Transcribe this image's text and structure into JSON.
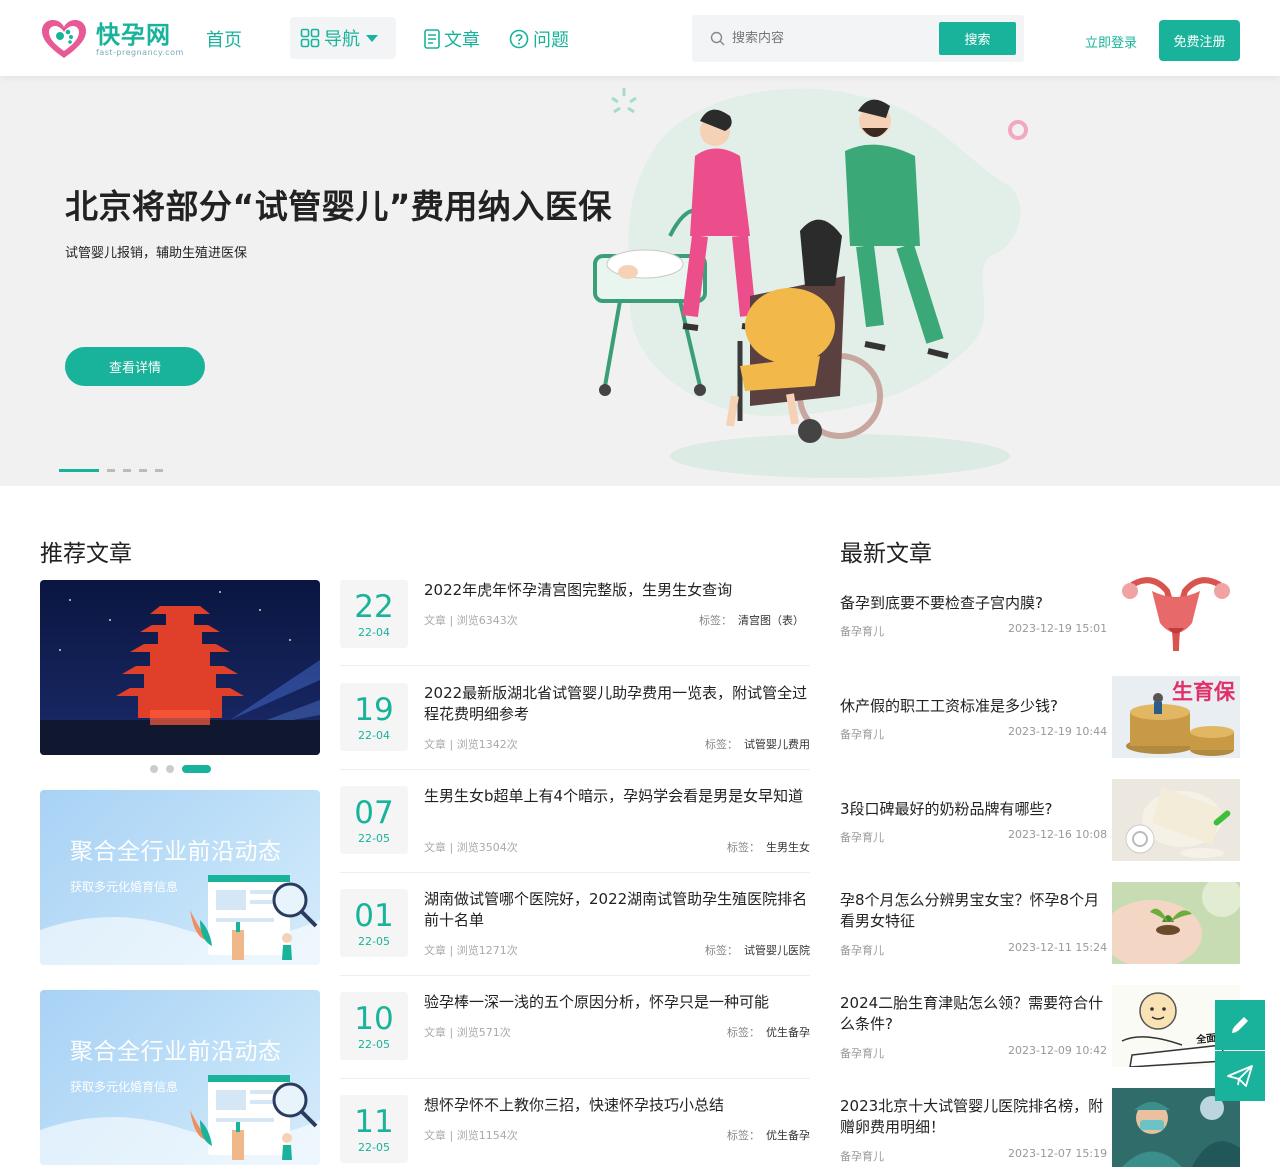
{
  "header": {
    "logo_title": "快孕网",
    "logo_sub": "fast-pregnancy.com",
    "nav_home": "首页",
    "nav_dropdown": "导航",
    "nav_articles": "文章",
    "nav_questions": "问题",
    "search_placeholder": "搜索内容",
    "search_button": "搜索",
    "login": "立即登录",
    "register": "免费注册"
  },
  "banner": {
    "title": "北京将部分“试管婴儿”费用纳入医保",
    "subtitle": "试管婴儿报销，辅助生殖进医保",
    "button": "查看详情",
    "slide_count": 5,
    "active_slide": 1
  },
  "recommended": {
    "heading": "推荐文章",
    "slider_dots": 3,
    "slider_active": 3,
    "promos": [
      {
        "title": "聚合全行业前沿动态",
        "subtitle": "获取多元化婚育信息"
      },
      {
        "title": "聚合全行业前沿动态",
        "subtitle": "获取多元化婚育信息"
      }
    ],
    "articles": [
      {
        "day": "22",
        "ym": "22-04",
        "title": "2022年虎年怀孕清宫图完整版，生男生女查询",
        "meta": "文章 | 浏览6343次",
        "tag_label": "标签：",
        "tag": "清宫图（表）"
      },
      {
        "day": "19",
        "ym": "22-04",
        "title": "2022最新版湖北省试管婴儿助孕费用一览表，附试管全过程花费明细参考",
        "meta": "文章 | 浏览1342次",
        "tag_label": "标签：",
        "tag": "试管婴儿费用"
      },
      {
        "day": "07",
        "ym": "22-05",
        "title": "生男生女b超单上有4个暗示，孕妈学会看是男是女早知道",
        "meta": "文章 | 浏览3504次",
        "tag_label": "标签：",
        "tag": "生男生女"
      },
      {
        "day": "01",
        "ym": "22-05",
        "title": "湖南做试管哪个医院好，2022湖南试管助孕生殖医院排名前十名单",
        "meta": "文章 | 浏览1271次",
        "tag_label": "标签：",
        "tag": "试管婴儿医院"
      },
      {
        "day": "10",
        "ym": "22-05",
        "title": "验孕棒一深一浅的五个原因分析，怀孕只是一种可能",
        "meta": "文章 | 浏览571次",
        "tag_label": "标签：",
        "tag": "优生备孕"
      },
      {
        "day": "11",
        "ym": "22-05",
        "title": "想怀孕怀不上教你三招，快速怀孕技巧小总结",
        "meta": "文章 | 浏览1154次",
        "tag_label": "标签：",
        "tag": "优生备孕"
      }
    ]
  },
  "latest": {
    "heading": "最新文章",
    "items": [
      {
        "title": "备孕到底要不要检查子宫内膜?",
        "category": "备孕育儿",
        "time": "2023-12-19 15:01",
        "image": "uterus-illustration"
      },
      {
        "title": "休产假的职工工资标准是多少钱?",
        "category": "备孕育儿",
        "time": "2023-12-19 10:44",
        "image": "coins-photo",
        "image_text": "生育保"
      },
      {
        "title": "3段口碑最好的奶粉品牌有哪些?",
        "category": "备孕育儿",
        "time": "2023-12-16 10:08",
        "image": "milk-powder-photo"
      },
      {
        "title": "孕8个月怎么分辨男宝女宝？怀孕8个月看男女特征",
        "category": "备孕育儿",
        "time": "2023-12-11 15:24",
        "image": "pregnant-belly-photo"
      },
      {
        "title": "2024二胎生育津贴怎么领？需要符合什么条件?",
        "category": "备孕育儿",
        "time": "2023-12-09 10:42",
        "image": "cartoon-baby",
        "image_text": "全面二孩"
      },
      {
        "title": "2023北京十大试管婴儿医院排名榜，附赠卵费用明细！",
        "category": "备孕育儿",
        "time": "2023-12-07 15:19",
        "image": "surgery-photo"
      }
    ]
  },
  "float": {
    "edit_icon": "pencil-icon",
    "send_icon": "paper-plane-icon"
  },
  "colors": {
    "accent": "#19b39b",
    "banner_bg": "#f1f1f1"
  }
}
